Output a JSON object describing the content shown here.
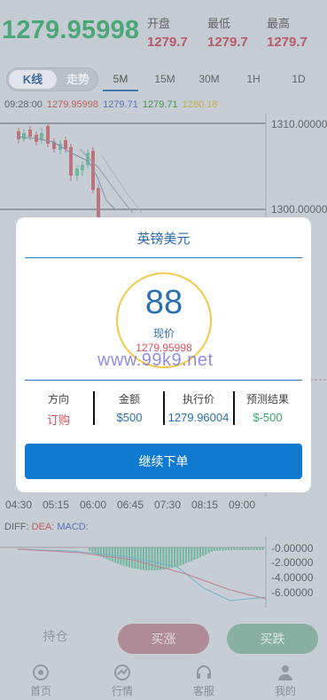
{
  "quote": {
    "last_price": "1279.95998",
    "stats": [
      {
        "label": "开盘",
        "value": "1279.7"
      },
      {
        "label": "最低",
        "value": "1279.7"
      },
      {
        "label": "最高",
        "value": "1279.7"
      }
    ]
  },
  "chart_tabs": {
    "kline": "K线",
    "trend": "走势",
    "timeframes": [
      "5M",
      "15M",
      "30M",
      "1H",
      "1D"
    ],
    "active_timeframe": "5M"
  },
  "legend": {
    "time": "09:28:00",
    "values": [
      {
        "text": "1279.95998",
        "color": "#c0504d"
      },
      {
        "text": "1279.71",
        "color": "#5066b0"
      },
      {
        "text": "1279.71",
        "color": "#3a8a3a"
      },
      {
        "text": "1280.18",
        "color": "#c7b23a"
      }
    ]
  },
  "chart_data": {
    "type": "candlestick",
    "y_ticks": [
      "1310.00000",
      "1300.00000"
    ],
    "x_ticks": [
      "04:30",
      "05:15",
      "06:00",
      "06:45",
      "07:30",
      "08:15",
      "09:00"
    ],
    "macd": {
      "labels": {
        "diff": "DIFF:",
        "dea": "DEA:",
        "macd": "MACD:"
      },
      "y_ticks": [
        "-0.00000",
        "-2.00000",
        "-4.00000",
        "-6.00000"
      ]
    }
  },
  "modal": {
    "title": "英镑美元",
    "countdown": "88",
    "now_label": "现价",
    "now_price": "1279.95998",
    "watermark": "www.99k9.net",
    "fields": [
      {
        "label": "方向",
        "value": "订购",
        "color": "#d9505d"
      },
      {
        "label": "金额",
        "value": "$500",
        "color": "#2a6fb0"
      },
      {
        "label": "执行价",
        "value": "1279.96004",
        "color": "#2a6fb0"
      },
      {
        "label": "预测结果",
        "value": "$-500",
        "color": "#3aa46a"
      }
    ],
    "continue_button": "继续下单"
  },
  "actions": {
    "hold": "持仓",
    "rise": "买涨",
    "fall": "买跌"
  },
  "nav": [
    {
      "label": "首页",
      "icon": "home-icon"
    },
    {
      "label": "行情",
      "icon": "chart-icon"
    },
    {
      "label": "客服",
      "icon": "headset-icon"
    },
    {
      "label": "我的",
      "icon": "user-icon"
    }
  ]
}
